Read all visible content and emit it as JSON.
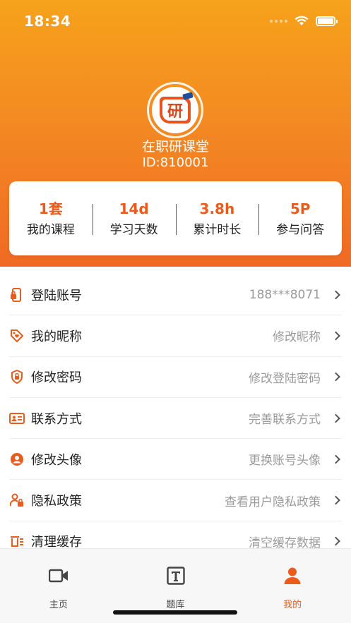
{
  "status_bar": {
    "time": "18:34"
  },
  "profile": {
    "avatar_char": "研",
    "name": "在职研课堂",
    "id_text": "ID:810001"
  },
  "stats": [
    {
      "value": "1套",
      "label": "我的课程"
    },
    {
      "value": "14d",
      "label": "学习天数"
    },
    {
      "value": "3.8h",
      "label": "累计时长"
    },
    {
      "value": "5P",
      "label": "参与问答"
    }
  ],
  "menu": [
    {
      "label": "登陆账号",
      "value": "188***8071",
      "icon": "phone-lock-icon"
    },
    {
      "label": "我的昵称",
      "value": "修改昵称",
      "icon": "tag-heart-icon"
    },
    {
      "label": "修改密码",
      "value": "修改登陆密码",
      "icon": "shield-lock-icon"
    },
    {
      "label": "联系方式",
      "value": "完善联系方式",
      "icon": "contact-card-icon"
    },
    {
      "label": "修改头像",
      "value": "更换账号头像",
      "icon": "user-circle-icon"
    },
    {
      "label": "隐私政策",
      "value": "查看用户隐私政策",
      "icon": "user-lock-icon"
    },
    {
      "label": "清理缓存",
      "value": "清空缓存数据",
      "icon": "trash-icon"
    }
  ],
  "tabbar": [
    {
      "label": "主页",
      "icon": "video-camera-icon",
      "active": false
    },
    {
      "label": "题库",
      "icon": "text-box-icon",
      "active": false
    },
    {
      "label": "我的",
      "icon": "person-icon",
      "active": true
    }
  ],
  "colors": {
    "accent": "#ea5b1c",
    "header_top": "#f7a21b",
    "header_bottom": "#f06a24"
  }
}
